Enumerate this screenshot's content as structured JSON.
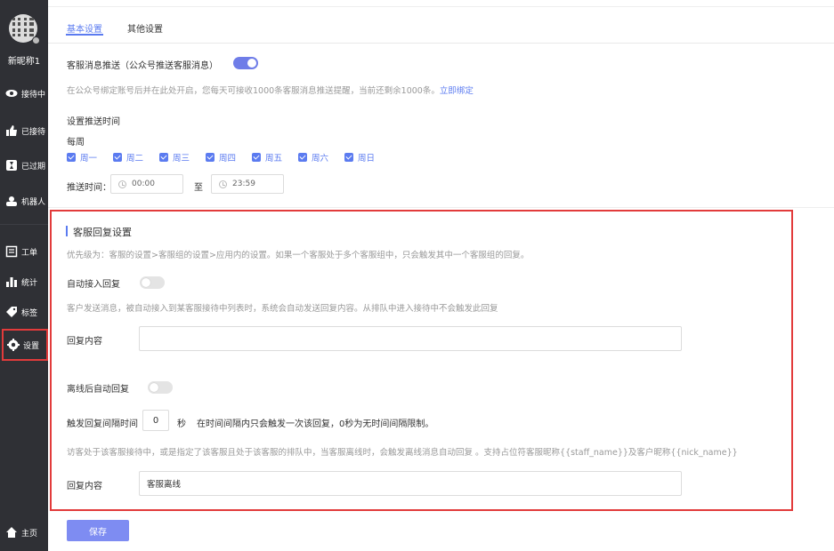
{
  "sidebar": {
    "nickname": "新昵称1",
    "items": [
      {
        "label": "接待中",
        "icon": "eye-icon"
      },
      {
        "label": "已接待",
        "icon": "thumbs-up-icon"
      },
      {
        "label": "已过期",
        "icon": "hourglass-icon"
      },
      {
        "label": "机器人",
        "icon": "robot-icon"
      },
      {
        "label": "工单",
        "icon": "ticket-icon"
      },
      {
        "label": "统计",
        "icon": "bar-chart-icon"
      },
      {
        "label": "标签",
        "icon": "tag-icon"
      },
      {
        "label": "设置",
        "icon": "gear-icon"
      },
      {
        "label": "主页",
        "icon": "home-icon"
      }
    ]
  },
  "tabs": [
    {
      "label": "基本设置",
      "active": true
    },
    {
      "label": "其他设置",
      "active": false
    }
  ],
  "push": {
    "label": "客服消息推送（公众号推送客服消息）",
    "enabled": true,
    "hint": "在公众号绑定账号后并在此处开启，您每天可接收1000条客服消息推送提醒，当前还剩余1000条。",
    "bind_link": "立即绑定",
    "time_title": "设置推送时间",
    "week_label": "每周",
    "days": [
      "周一",
      "周二",
      "周三",
      "周四",
      "周五",
      "周六",
      "周日"
    ],
    "time_label": "推送时间：",
    "start_time": "00:00",
    "to_label": "至",
    "end_time": "23:59"
  },
  "reply": {
    "title": "客服回复设置",
    "priority_hint": "优先级为：客服的设置>客服组的设置>应用内的设置。如果一个客服处于多个客服组中，只会触发其中一个客服组的回复。",
    "auto_label": "自动接入回复",
    "auto_enabled": false,
    "auto_hint": "客户发送消息，被自动接入到某客服接待中列表时，系统会自动发送回复内容。从排队中进入接待中不会触发此回复",
    "content_label": "回复内容",
    "content_value": "",
    "offline_label": "离线后自动回复",
    "offline_enabled": false,
    "interval_label": "触发回复间隔时间",
    "interval_value": "0",
    "interval_unit": "秒",
    "interval_hint": "在时间间隔内只会触发一次该回复，0秒为无时间间隔限制。",
    "offline_hint": "访客处于该客服接待中，或是指定了该客服且处于该客服的排队中，当客服离线时，会触发离线消息自动回复 。支持占位符客服昵称{{staff_name}}及客户昵称{{nick_name}}",
    "offline_content_label": "回复内容",
    "offline_content_value": "客服离线"
  },
  "save_label": "保存",
  "colors": {
    "accent": "#5b7bf0",
    "sidebar": "#2f3035",
    "highlight": "#e23b3b"
  }
}
